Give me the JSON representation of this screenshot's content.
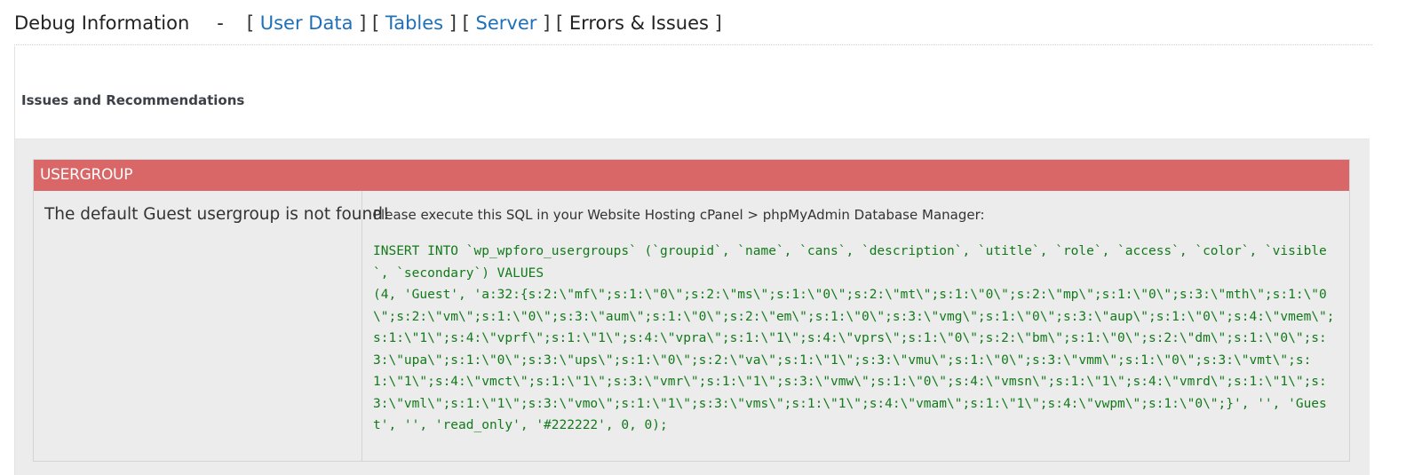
{
  "header": {
    "title": "Debug Information",
    "separator": "-",
    "nav": [
      {
        "label": "User Data",
        "link": true
      },
      {
        "label": "Tables",
        "link": true
      },
      {
        "label": "Server",
        "link": true
      },
      {
        "label": "Errors & Issues",
        "link": false
      }
    ]
  },
  "section": {
    "title": "Issues and Recommendations"
  },
  "issue": {
    "heading": "USERGROUP",
    "problem": "The default Guest usergroup is not found!",
    "instruction": "Please execute this SQL in your Website Hosting cPanel > phpMyAdmin Database Manager:",
    "sql": "INSERT INTO `wp_wpforo_usergroups` (`groupid`, `name`, `cans`, `description`, `utitle`, `role`, `access`, `color`, `visible`, `secondary`) VALUES\n(4, 'Guest', 'a:32:{s:2:\\\"mf\\\";s:1:\\\"0\\\";s:2:\\\"ms\\\";s:1:\\\"0\\\";s:2:\\\"mt\\\";s:1:\\\"0\\\";s:2:\\\"mp\\\";s:1:\\\"0\\\";s:3:\\\"mth\\\";s:1:\\\"0\\\";s:2:\\\"vm\\\";s:1:\\\"0\\\";s:3:\\\"aum\\\";s:1:\\\"0\\\";s:2:\\\"em\\\";s:1:\\\"0\\\";s:3:\\\"vmg\\\";s:1:\\\"0\\\";s:3:\\\"aup\\\";s:1:\\\"0\\\";s:4:\\\"vmem\\\";s:1:\\\"1\\\";s:4:\\\"vprf\\\";s:1:\\\"1\\\";s:4:\\\"vpra\\\";s:1:\\\"1\\\";s:4:\\\"vprs\\\";s:1:\\\"0\\\";s:2:\\\"bm\\\";s:1:\\\"0\\\";s:2:\\\"dm\\\";s:1:\\\"0\\\";s:3:\\\"upa\\\";s:1:\\\"0\\\";s:3:\\\"ups\\\";s:1:\\\"0\\\";s:2:\\\"va\\\";s:1:\\\"1\\\";s:3:\\\"vmu\\\";s:1:\\\"0\\\";s:3:\\\"vmm\\\";s:1:\\\"0\\\";s:3:\\\"vmt\\\";s:1:\\\"1\\\";s:4:\\\"vmct\\\";s:1:\\\"1\\\";s:3:\\\"vmr\\\";s:1:\\\"1\\\";s:3:\\\"vmw\\\";s:1:\\\"0\\\";s:4:\\\"vmsn\\\";s:1:\\\"1\\\";s:4:\\\"vmrd\\\";s:1:\\\"1\\\";s:3:\\\"vml\\\";s:1:\\\"1\\\";s:3:\\\"vmo\\\";s:1:\\\"1\\\";s:3:\\\"vms\\\";s:1:\\\"1\\\";s:4:\\\"vmam\\\";s:1:\\\"1\\\";s:4:\\\"vwpm\\\";s:1:\\\"0\\\";}', '', 'Guest', '', 'read_only', '#222222', 0, 0);"
  },
  "colors": {
    "heading_bg": "#d96767",
    "link": "#1f70b8",
    "sql_text": "#127a1a",
    "panel_bg": "#ececec"
  }
}
